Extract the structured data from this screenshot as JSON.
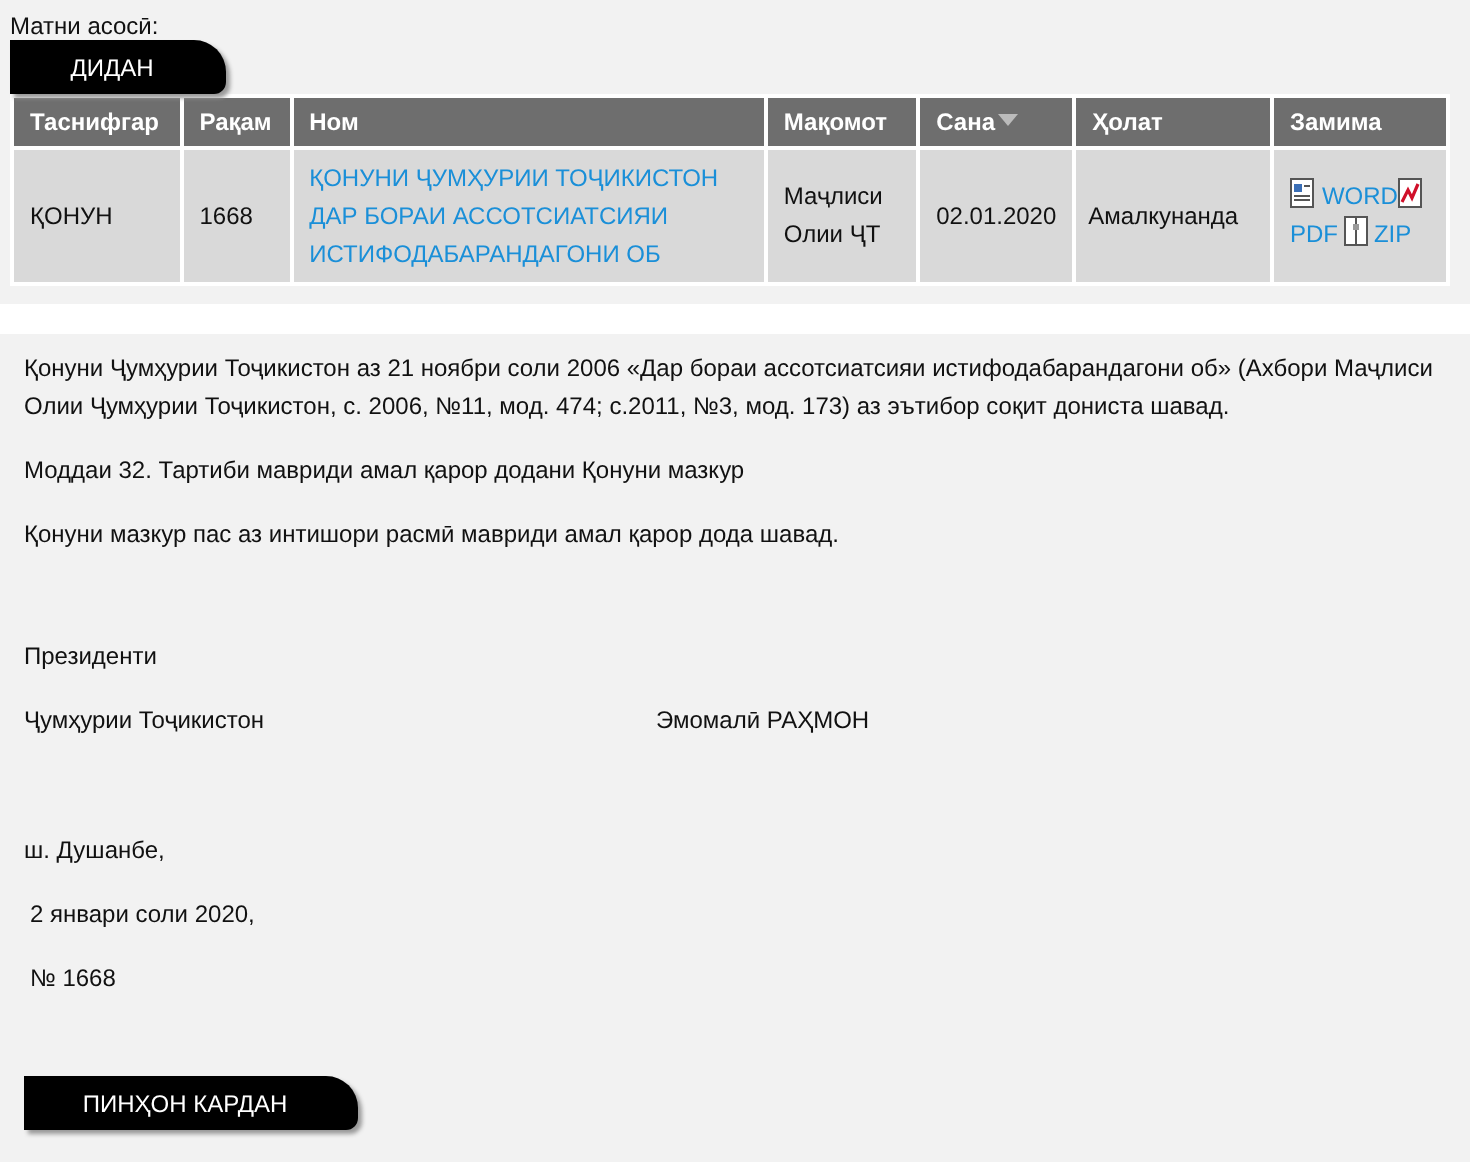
{
  "basis_label": "Матни асосӣ:",
  "view_button": "ДИДАН",
  "table": {
    "columns": [
      {
        "label": "Таснифгар",
        "sorted": false
      },
      {
        "label": "Рақам",
        "sorted": false
      },
      {
        "label": "Ном",
        "sorted": false
      },
      {
        "label": "Мақомот",
        "sorted": false
      },
      {
        "label": "Сана",
        "sorted": true
      },
      {
        "label": "Ҳолат",
        "sorted": false
      },
      {
        "label": "Замима",
        "sorted": false
      }
    ],
    "rows": [
      {
        "type": "ҚОНУН",
        "number": "1668",
        "title": "ҚОНУНИ ҶУМҲУРИИ ТОҶИКИСТОН ДАР БОРАИ АССОТСИАТСИЯИ ИСТИФОДАБАРАНДАГОНИ ОБ",
        "authority": "Маҷлиси Олии ҶТ",
        "date": "02.01.2020",
        "status": "Амалкунанда",
        "attachments": [
          {
            "kind": "word",
            "label": "WORD"
          },
          {
            "kind": "pdf",
            "label": "PDF"
          },
          {
            "kind": "zip",
            "label": "ZIP"
          }
        ]
      }
    ]
  },
  "document": {
    "paragraphs": [
      "Қонуни Ҷумҳурии Тоҷикистон аз 21 ноябри соли 2006 «Дар бораи ассотсиатсияи истифодабарандагони об» (Ахбори Маҷлиси Олии Ҷумҳурии Тоҷикистон, с. 2006, №11, мод. 474; с.2011, №3, мод. 173) аз эътибор соқит дониста шавад.",
      "Моддаи 32. Тартиби мавриди амал қарор додани Қонуни мазкур",
      "Қонуни мазкур пас аз интишори расмӣ мавриди амал қарор дода шавад."
    ],
    "signature": {
      "title": "Президенти",
      "country": "Ҷумҳурии Тоҷикистон",
      "name": "Эмомалӣ РАҲМОН",
      "place": "ш. Душанбе,",
      "date": "2 январи соли 2020,",
      "number": "№ 1668"
    }
  },
  "hide_button": "ПИНҲОН КАРДАН"
}
